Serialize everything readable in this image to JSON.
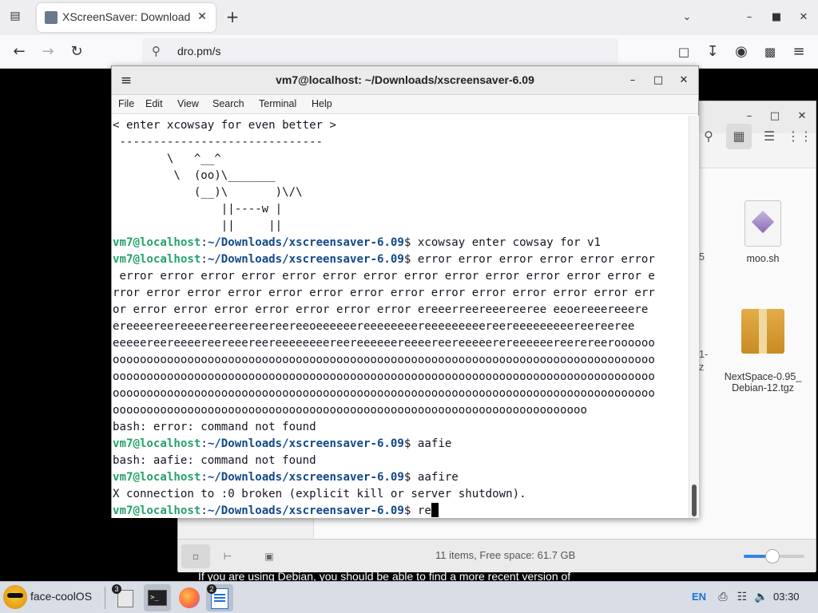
{
  "browser": {
    "tab_title": "XScreenSaver: Download",
    "url": "dro.pm/s",
    "page_text": "If you are using Debian, you should be able to find a more recent version of"
  },
  "file_manager": {
    "files": [
      {
        "name": "moo.sh",
        "icon": "script-file-icon"
      },
      {
        "name": "NextSpace-0.95_\nDebian-12.tgz",
        "icon": "archive-icon"
      }
    ],
    "partial_labels": [
      "5",
      "1-",
      "z"
    ],
    "status": "11 items, Free space: 61.7 GB",
    "zoom_level": 0.48
  },
  "terminal": {
    "title": "vm7@localhost: ~/Downloads/xscreensaver-6.09",
    "menu": [
      "File",
      "Edit",
      "View",
      "Search",
      "Terminal",
      "Help"
    ],
    "lines": [
      {
        "text": "< enter xcowsay for even better >"
      },
      {
        "text": " ------------------------------"
      },
      {
        "text": "        \\   ^__^"
      },
      {
        "text": "         \\  (oo)\\_______"
      },
      {
        "text": "            (__)\\       )\\/\\"
      },
      {
        "text": "                ||----w |"
      },
      {
        "text": "                ||     ||"
      },
      {
        "prompt_user": "vm7@localhost",
        "prompt_path": "~/Downloads/xscreensaver-6.09",
        "cmd": "xcowsay enter cowsay for v1"
      },
      {
        "prompt_user": "vm7@localhost",
        "prompt_path": "~/Downloads/xscreensaver-6.09",
        "cmd": "error error error error error error"
      },
      {
        "text": " error error error error error error error error error error error error error e"
      },
      {
        "text": "rror error error error error error error error error error error error error err"
      },
      {
        "text": "or error error error error error error error ereeerreereeereeree eeoereeereeere"
      },
      {
        "text": "ereeeereereeeereereereereereeoeeeeeereeeeeeeereeeeeeeeereereeeeeeeeereereeree"
      },
      {
        "text": "eeeeereereeeereereeereereeeeeeeereereeeeeereeeereereeeeerereeeeeereerereeroooooo"
      },
      {
        "text": "oooooooooooooooooooooooooooooooooooooooooooooooooooooooooooooooooooooooooooooooo"
      },
      {
        "text": "oooooooooooooooooooooooooooooooooooooooooooooooooooooooooooooooooooooooooooooooo"
      },
      {
        "text": "oooooooooooooooooooooooooooooooooooooooooooooooooooooooooooooooooooooooooooooooo"
      },
      {
        "text": "oooooooooooooooooooooooooooooooooooooooooooooooooooooooooooooooooooooo"
      },
      {
        "text": "bash: error: command not found"
      },
      {
        "prompt_user": "vm7@localhost",
        "prompt_path": "~/Downloads/xscreensaver-6.09",
        "cmd": "aafie"
      },
      {
        "text": "bash: aafie: command not found"
      },
      {
        "prompt_user": "vm7@localhost",
        "prompt_path": "~/Downloads/xscreensaver-6.09",
        "cmd": "aafire"
      },
      {
        "text": "X connection to :0 broken (explicit kill or server shutdown)."
      },
      {
        "prompt_user": "vm7@localhost",
        "prompt_path": "~/Downloads/xscreensaver-6.09",
        "cmd": "re",
        "cursor": true
      }
    ]
  },
  "taskbar": {
    "start_label": "face-coolOS",
    "badges": {
      "files": "3",
      "writer": "2"
    },
    "language": "EN",
    "clock": "03:30"
  }
}
